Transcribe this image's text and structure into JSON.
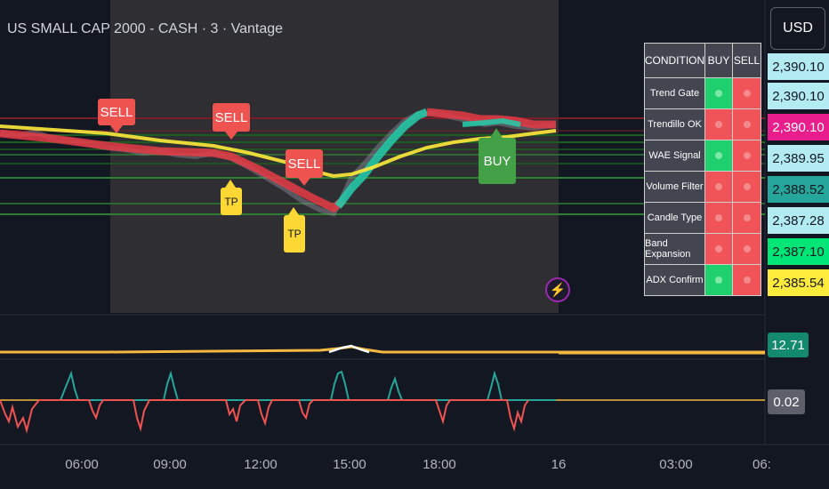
{
  "header": {
    "title": "US SMALL CAP 2000 - CASH · 3 · Vantage",
    "currency_button": "USD"
  },
  "markers": {
    "sell_label": "SELL",
    "buy_label": "BUY",
    "tp_label": "TP"
  },
  "condition_table": {
    "headers": [
      "CONDITION",
      "BUY",
      "SELL"
    ],
    "rows": [
      {
        "label": "Trend Gate",
        "buy": "on",
        "sell": "off"
      },
      {
        "label": "Trendillo OK",
        "buy": "off",
        "sell": "off"
      },
      {
        "label": "WAE Signal",
        "buy": "on",
        "sell": "off"
      },
      {
        "label": "Volume Filter",
        "buy": "off",
        "sell": "off"
      },
      {
        "label": "Candle Type",
        "buy": "off",
        "sell": "off"
      },
      {
        "label": "Band Expansion",
        "buy": "off",
        "sell": "off"
      },
      {
        "label": "ADX Confirm",
        "buy": "on",
        "sell": "off"
      }
    ]
  },
  "price_scale": {
    "tags": [
      {
        "value": "2,390.10",
        "color": "#b2ebf2"
      },
      {
        "value": "2,390.10",
        "color": "#b2ebf2"
      },
      {
        "value": "2,390.10",
        "color": "#e91e8c"
      },
      {
        "value": "2,389.95",
        "color": "#b2ebf2"
      },
      {
        "value": "2,388.52",
        "color": "#26a69a"
      },
      {
        "value": "2,387.28",
        "color": "#b2ebf2"
      },
      {
        "value": "2,387.10",
        "color": "#00e676"
      },
      {
        "value": "2,385.54",
        "color": "#ffeb3b"
      }
    ]
  },
  "indicators": {
    "volume_value": "12.71",
    "oscillator_value": "0.02"
  },
  "time_axis": {
    "labels": [
      "06:00",
      "09:00",
      "12:00",
      "15:00",
      "18:00",
      "16",
      "03:00",
      "06:"
    ]
  },
  "colors": {
    "background": "#131722",
    "session_highlight": "#2f2f33",
    "sell_marker": "#ef5350",
    "buy_marker": "#43a047",
    "tp_marker": "#fdd835",
    "ma_yellow": "#ffeb3b",
    "band_red": "#e53945",
    "band_teal": "#26c6a6",
    "level_green": "#1b5e20",
    "level_red": "#7a1f28",
    "on_green": "#1fd16e",
    "off_red": "#f05458"
  }
}
